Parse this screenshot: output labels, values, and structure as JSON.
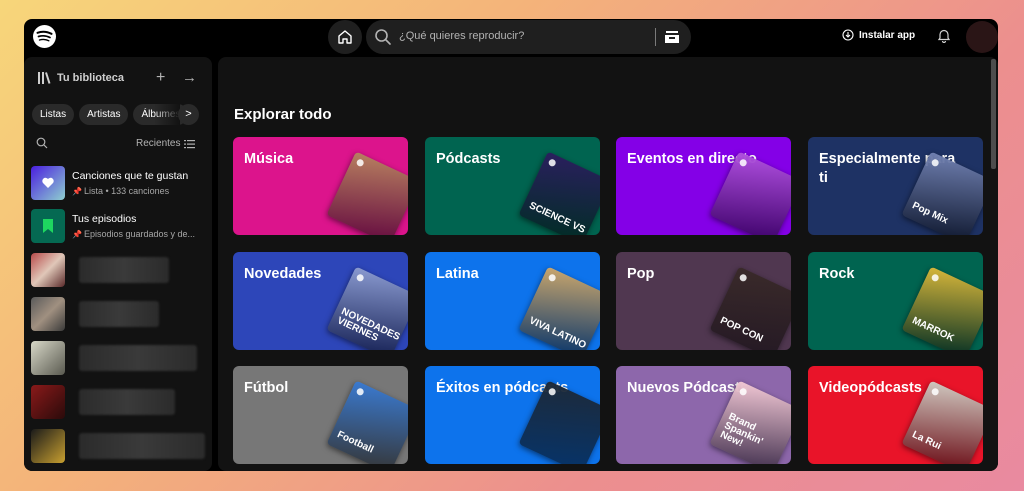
{
  "topbar": {
    "search_placeholder": "¿Qué quieres reproducir?",
    "install_label": "Instalar app"
  },
  "sidebar": {
    "title": "Tu biblioteca",
    "chips": [
      "Listas",
      "Artistas",
      "Álbumes"
    ],
    "sort_label": "Recientes",
    "items": [
      {
        "title": "Canciones que te gustan",
        "subtitle": "Lista • 133 canciones"
      },
      {
        "title": "Tus episodios",
        "subtitle": "Episodios guardados y de..."
      }
    ]
  },
  "main": {
    "title": "Explorar todo",
    "cards": [
      {
        "label": "Música",
        "color": "#dc148c",
        "art": "#b88060",
        "art_text": ""
      },
      {
        "label": "Pódcasts",
        "color": "#006450",
        "art": "#2a1f5e",
        "art_text": "SCIENCE VS"
      },
      {
        "label": "Eventos en directo",
        "color": "#8400e7",
        "art": "#b04fe0",
        "art_text": ""
      },
      {
        "label": "Especialmente para ti",
        "color": "#1e3264",
        "art": "#6f7fb0",
        "art_text": "Pop Mix"
      },
      {
        "label": "Novedades",
        "color": "#2d46b9",
        "art": "#8a9ad0",
        "art_text": "NOVEDADES VIERNES"
      },
      {
        "label": "Latina",
        "color": "#0d73ec",
        "art": "#c9a66d",
        "art_text": "VIVA LATINO"
      },
      {
        "label": "Pop",
        "color": "#503750",
        "art": "#3a2a2a",
        "art_text": "POP CON"
      },
      {
        "label": "Rock",
        "color": "#006450",
        "art": "#d6b63a",
        "art_text": "MARROK"
      },
      {
        "label": "Fútbol",
        "color": "#777777",
        "art": "#3a7ad0",
        "art_text": "Football"
      },
      {
        "label": "Éxitos en pódcasts",
        "color": "#0d73ec",
        "art": "#1d2a3a",
        "art_text": ""
      },
      {
        "label": "Nuevos Pódcasts",
        "color": "#8d67ab",
        "art": "#f1c7d4",
        "art_text": "Brand Spankin' New!"
      },
      {
        "label": "Videopódcasts",
        "color": "#e91429",
        "art": "#d0c8c0",
        "art_text": "La Rui"
      }
    ]
  }
}
